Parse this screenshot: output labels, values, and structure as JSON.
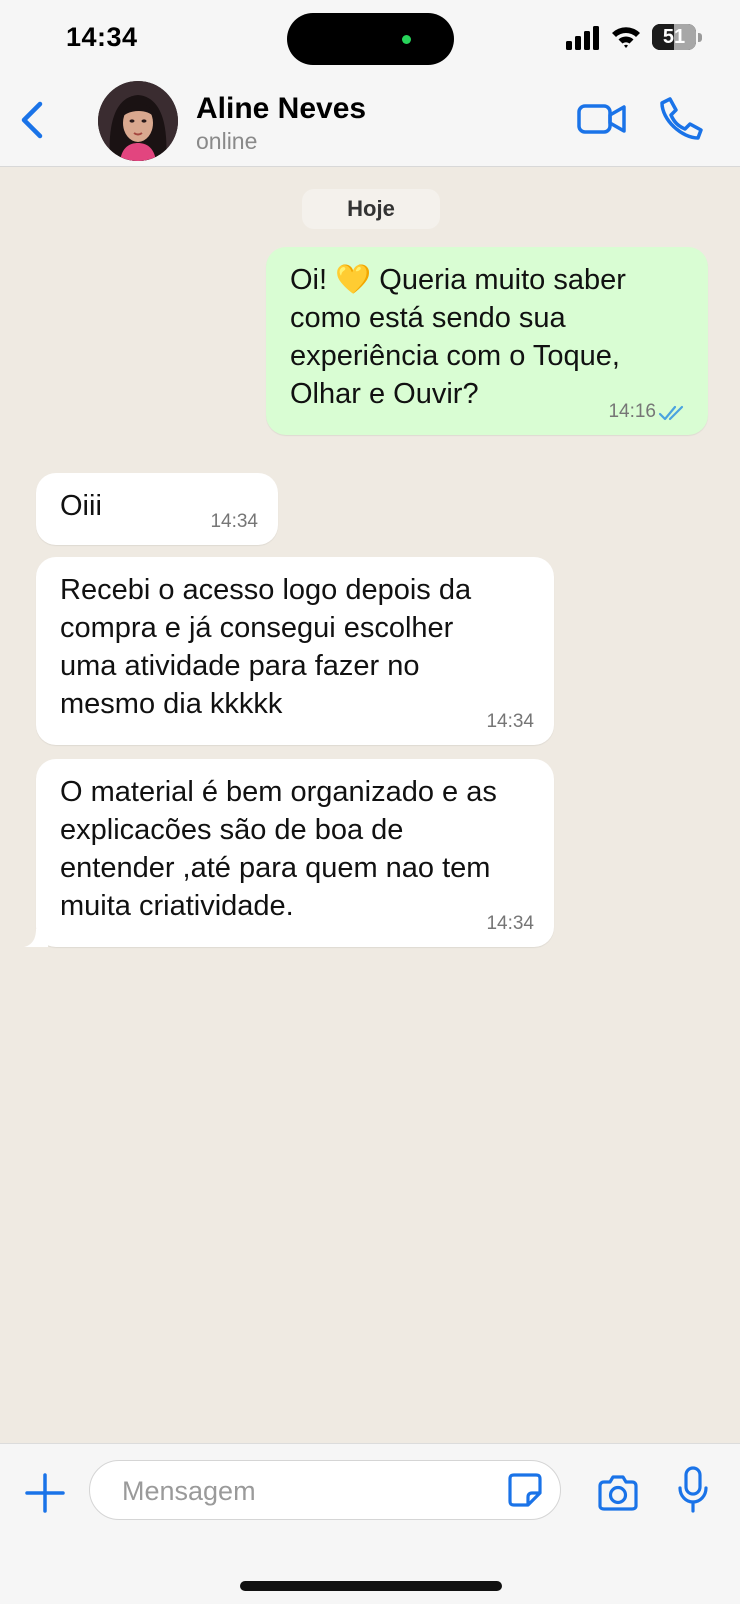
{
  "status_bar": {
    "time": "14:34",
    "battery_level": "51",
    "battery_fraction": 0.51
  },
  "header": {
    "back_icon": "chevron-left-icon",
    "contact_name": "Aline Neves",
    "contact_status": "online",
    "video_icon": "video-camera-icon",
    "phone_icon": "phone-icon"
  },
  "chat": {
    "date_label": "Hoje",
    "messages": [
      {
        "direction": "outgoing",
        "text": "Oi! 💛 Queria muito saber\ncomo está sendo sua\nexperiência com o Toque,\nOlhar e Ouvir?",
        "time": "14:16",
        "status": "read"
      },
      {
        "direction": "incoming",
        "text": "Oiii",
        "time": "14:34"
      },
      {
        "direction": "incoming",
        "text": "Recebi o acesso logo depois da\ncompra e já consegui escolher\numa atividade para fazer no\nmesmo dia kkkkk",
        "time": "14:34"
      },
      {
        "direction": "incoming",
        "text": "O material é bem organizado e as\nexplicacões são de boa de\nentender ,até para quem nao tem\nmuita criatividade.",
        "time": "14:34"
      }
    ]
  },
  "input_bar": {
    "placeholder": "Mensagem",
    "value": "",
    "icons": [
      "plus-icon",
      "sticker-icon",
      "camera-icon",
      "microphone-icon"
    ]
  },
  "colors": {
    "accent": "#1a73e8",
    "outgoing_bubble": "#d9fdd3",
    "incoming_bubble": "#ffffff",
    "chat_background": "#efeae2",
    "read_receipt": "#4aa3df"
  }
}
